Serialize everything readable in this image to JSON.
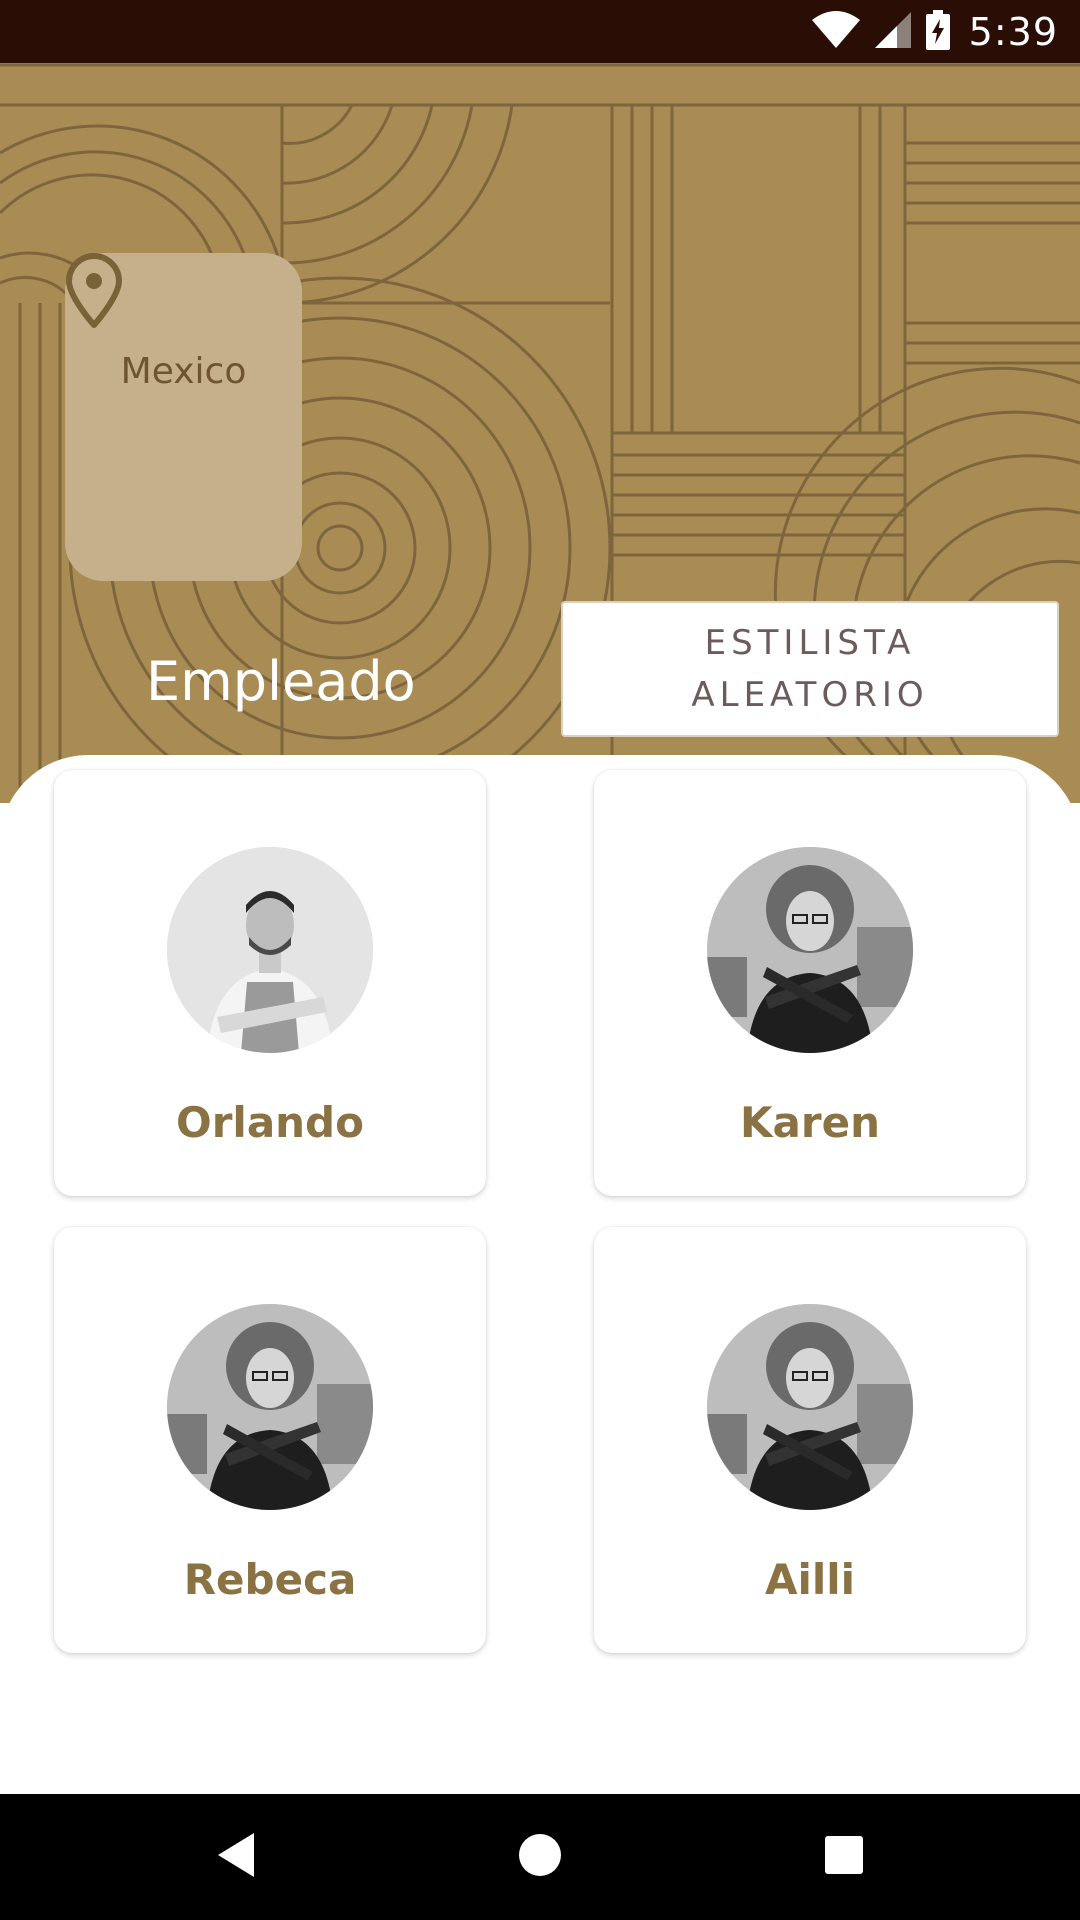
{
  "status_bar": {
    "time": "5:39",
    "icons": [
      "wifi-icon",
      "signal-icon",
      "battery-charging-icon"
    ]
  },
  "location": {
    "icon": "map-pin-icon",
    "label": "Mexico"
  },
  "section": {
    "title": "Empleado"
  },
  "random_button": {
    "label": "ESTILISTA ALEATORIO"
  },
  "employees": [
    {
      "name": "Orlando"
    },
    {
      "name": "Karen"
    },
    {
      "name": "Rebeca"
    },
    {
      "name": "Ailli"
    }
  ],
  "nav": {
    "icons": [
      "back-icon",
      "home-icon",
      "recents-icon"
    ]
  },
  "colors": {
    "header": "#a98b54",
    "accent_text": "#8a7243",
    "status_bar": "#2a0e05"
  }
}
